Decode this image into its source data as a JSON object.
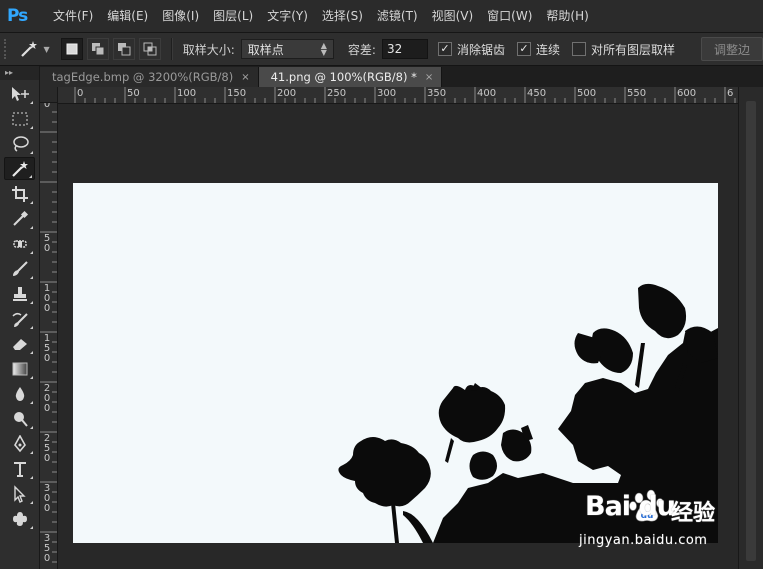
{
  "app": {
    "logo_text": "Ps"
  },
  "menu": [
    "文件(F)",
    "编辑(E)",
    "图像(I)",
    "图层(L)",
    "文字(Y)",
    "选择(S)",
    "滤镜(T)",
    "视图(V)",
    "窗口(W)",
    "帮助(H)"
  ],
  "options": {
    "sample_size_label": "取样大小:",
    "sample_size_value": "取样点",
    "tolerance_label": "容差:",
    "tolerance_value": "32",
    "anti_alias_label": "消除锯齿",
    "anti_alias_checked": true,
    "contiguous_label": "连续",
    "contiguous_checked": true,
    "all_layers_label": "对所有图层取样",
    "all_layers_checked": false,
    "refine_edge_label": "调整边"
  },
  "tools": [
    {
      "name": "move-tool",
      "icon": "move-icon",
      "active": false
    },
    {
      "name": "marquee-tool",
      "icon": "rect-marquee-icon",
      "active": false
    },
    {
      "name": "lasso-tool",
      "icon": "lasso-icon",
      "active": false
    },
    {
      "name": "magic-wand-tool",
      "icon": "magic-wand-icon",
      "active": true
    },
    {
      "name": "crop-tool",
      "icon": "crop-icon",
      "active": false
    },
    {
      "name": "eyedropper-tool",
      "icon": "eyedropper-icon",
      "active": false
    },
    {
      "name": "healing-brush-tool",
      "icon": "bandage-icon",
      "active": false
    },
    {
      "name": "brush-tool",
      "icon": "brush-icon",
      "active": false
    },
    {
      "name": "clone-stamp-tool",
      "icon": "stamp-icon",
      "active": false
    },
    {
      "name": "history-brush-tool",
      "icon": "history-brush-icon",
      "active": false
    },
    {
      "name": "eraser-tool",
      "icon": "eraser-icon",
      "active": false
    },
    {
      "name": "gradient-tool",
      "icon": "gradient-icon",
      "active": false
    },
    {
      "name": "blur-tool",
      "icon": "drop-icon",
      "active": false
    },
    {
      "name": "dodge-tool",
      "icon": "dodge-icon",
      "active": false
    },
    {
      "name": "pen-tool",
      "icon": "pen-icon",
      "active": false
    },
    {
      "name": "type-tool",
      "icon": "type-icon",
      "active": false
    },
    {
      "name": "path-selection-tool",
      "icon": "arrow-icon",
      "active": false
    },
    {
      "name": "custom-shape-tool",
      "icon": "shape-icon",
      "active": false
    }
  ],
  "tabs": [
    {
      "label": "tagEdge.bmp @ 3200%(RGB/8)",
      "close": "×",
      "active": false
    },
    {
      "label": "41.png @ 100%(RGB/8) *",
      "close": "×",
      "active": true
    }
  ],
  "ruler_h": [
    "0",
    "50",
    "100",
    "150",
    "200",
    "250",
    "300",
    "350",
    "400",
    "450",
    "500",
    "550",
    "600",
    "6"
  ],
  "ruler_v": [
    "0",
    "5\n0",
    "1\n0\n0",
    "1\n5\n0",
    "2\n0\n0",
    "2\n5\n0",
    "3\n0\n0",
    "3\n5\n0"
  ],
  "watermark": {
    "brand": "Bai du",
    "cn": "经验",
    "url": "jingyan.baidu.com"
  },
  "colors": {
    "canvas_bg": "#f3f9fb",
    "silhouette": "#0b0b0b",
    "ps_blue": "#31a8ff",
    "ui_bg": "#2b2b2b"
  }
}
